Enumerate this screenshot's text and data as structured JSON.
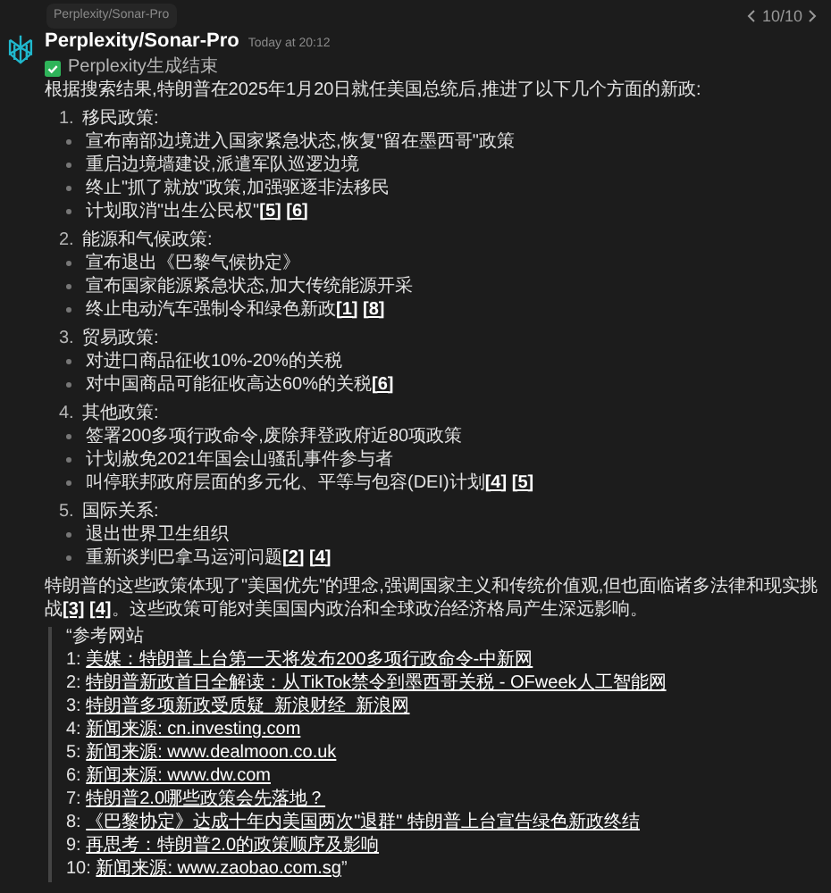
{
  "header": {
    "tag": "Perplexity/Sonar-Pro",
    "pager": "10/10"
  },
  "message": {
    "author": "Perplexity/Sonar-Pro",
    "time": "Today at 20:12",
    "status": {
      "checked": true,
      "text": "Perplexity生成结束"
    },
    "intro": "根据搜索结果,特朗普在2025年1月20日就任美国总统后,推进了以下几个方面的新政:",
    "sections": [
      {
        "number": "1.",
        "title": "移民政策:",
        "items": [
          {
            "text": "宣布南部边境进入国家紧急状态,恢复\"留在墨西哥\"政策"
          },
          {
            "text": "重启边境墙建设,派遣军队巡逻边境"
          },
          {
            "text": "终止\"抓了就放\"政策,加强驱逐非法移民"
          },
          {
            "text": "计划取消\"出生公民权\"",
            "refs": [
              "[5]",
              "[6]"
            ]
          }
        ]
      },
      {
        "number": "2.",
        "title": "能源和气候政策:",
        "items": [
          {
            "text": "宣布退出《巴黎气候协定》"
          },
          {
            "text": "宣布国家能源紧急状态,加大传统能源开采"
          },
          {
            "text": "终止电动汽车强制令和绿色新政",
            "refs": [
              "[1]",
              "[8]"
            ]
          }
        ]
      },
      {
        "number": "3.",
        "title": "贸易政策:",
        "items": [
          {
            "text": "对进口商品征收10%-20%的关税"
          },
          {
            "text": "对中国商品可能征收高达60%的关税",
            "refs": [
              "[6]"
            ]
          }
        ]
      },
      {
        "number": "4.",
        "title": "其他政策:",
        "items": [
          {
            "text": "签署200多项行政命令,废除拜登政府近80项政策"
          },
          {
            "text": "计划赦免2021年国会山骚乱事件参与者"
          },
          {
            "text": "叫停联邦政府层面的多元化、平等与包容(DEI)计划",
            "refs": [
              "[4]",
              "[5]"
            ]
          }
        ]
      },
      {
        "number": "5.",
        "title": "国际关系:",
        "items": [
          {
            "text": "退出世界卫生组织"
          },
          {
            "text": "重新谈判巴拿马运河问题",
            "refs": [
              "[2]",
              "[4]"
            ]
          }
        ]
      }
    ],
    "summary": {
      "before": "特朗普的这些政策体现了\"美国优先\"的理念,强调国家主义和传统价值观,但也面临诸多法律和现实挑战",
      "refs": [
        "[3]",
        "[4]"
      ],
      "after": "。这些政策可能对美国国内政治和全球政治经济格局产生深远影响。"
    },
    "references": {
      "title": "“参考网站",
      "items": [
        {
          "number": "1:",
          "title": "美媒：特朗普上台第一天将发布200多项行政命令-中新网"
        },
        {
          "number": "2:",
          "title": "特朗普新政首日全解读：从TikTok禁令到墨西哥关税 - OFweek人工智能网"
        },
        {
          "number": "3:",
          "title": "特朗普多项新政受质疑_新浪财经_新浪网"
        },
        {
          "number": "4:",
          "title": "新闻来源: cn.investing.com"
        },
        {
          "number": "5:",
          "title": "新闻来源: www.dealmoon.co.uk"
        },
        {
          "number": "6:",
          "title": "新闻来源: www.dw.com"
        },
        {
          "number": "7:",
          "title": "特朗普2.0哪些政策会先落地？"
        },
        {
          "number": "8:",
          "title": "《巴黎协定》达成十年内美国两次\"退群\" 特朗普上台宣告绿色新政终结"
        },
        {
          "number": "9:",
          "title": "再思考：特朗普2.0的政策顺序及影响"
        },
        {
          "number": "10:",
          "title": "新闻来源: www.zaobao.com.sg",
          "suffix": "”"
        }
      ]
    }
  }
}
